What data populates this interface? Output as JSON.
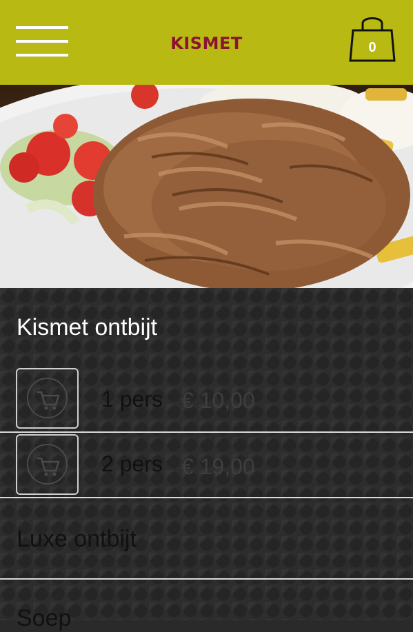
{
  "header": {
    "brand": "KISMET",
    "cart_count": "0",
    "colors": {
      "bar": "#b9b913",
      "brand_text": "#8b1530"
    }
  },
  "hero": {
    "image": "döner kebab plate with salad and fries"
  },
  "menu": {
    "section_title": "Kismet ontbijt",
    "items": [
      {
        "qty": "1 pers",
        "price": "€ 10,00"
      },
      {
        "qty": "2 pers",
        "price": "€ 19,00"
      }
    ],
    "categories": [
      {
        "label": "Luxe ontbijt"
      },
      {
        "label": "Soep"
      }
    ]
  }
}
